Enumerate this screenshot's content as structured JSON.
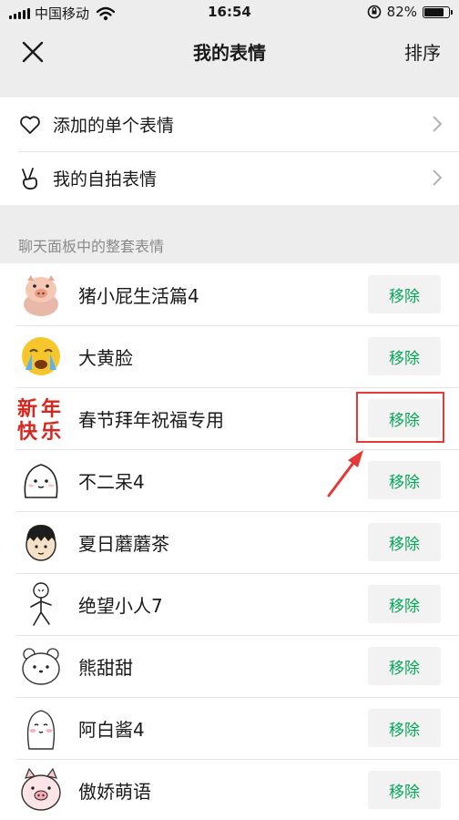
{
  "status_bar": {
    "carrier": "中国移动",
    "time": "16:54",
    "battery": "82%",
    "battery_level": 0.82
  },
  "nav": {
    "close_icon": "close-icon",
    "title": "我的表情",
    "sort_label": "排序"
  },
  "menu": [
    {
      "label": "添加的单个表情",
      "icon": "heart-icon"
    },
    {
      "label": "我的自拍表情",
      "icon": "victory-hand-icon"
    }
  ],
  "section_label": "聊天面板中的整套表情",
  "packs": [
    {
      "name": "猪小屁生活篇4",
      "button": "移除",
      "icon": "pig-sticker-icon"
    },
    {
      "name": "大黄脸",
      "button": "移除",
      "icon": "crying-face-icon"
    },
    {
      "name": "春节拜年祝福专用",
      "button": "移除",
      "icon": "new-year-text-icon",
      "thumb_text": [
        "新",
        "年",
        "快",
        "乐"
      ]
    },
    {
      "name": "不二呆4",
      "button": "移除",
      "icon": "white-blob-icon"
    },
    {
      "name": "夏日蘑蘑茶",
      "button": "移除",
      "icon": "bowl-cut-boy-icon"
    },
    {
      "name": "绝望小人7",
      "button": "移除",
      "icon": "stick-figure-icon"
    },
    {
      "name": "熊甜甜",
      "button": "移除",
      "icon": "white-bear-icon"
    },
    {
      "name": "阿白酱4",
      "button": "移除",
      "icon": "white-character-icon"
    },
    {
      "name": "傲娇萌语",
      "button": "移除",
      "icon": "pink-pig-icon"
    }
  ],
  "colors": {
    "accent": "#07a65a",
    "highlight": "#e53935",
    "background": "#ededed"
  }
}
